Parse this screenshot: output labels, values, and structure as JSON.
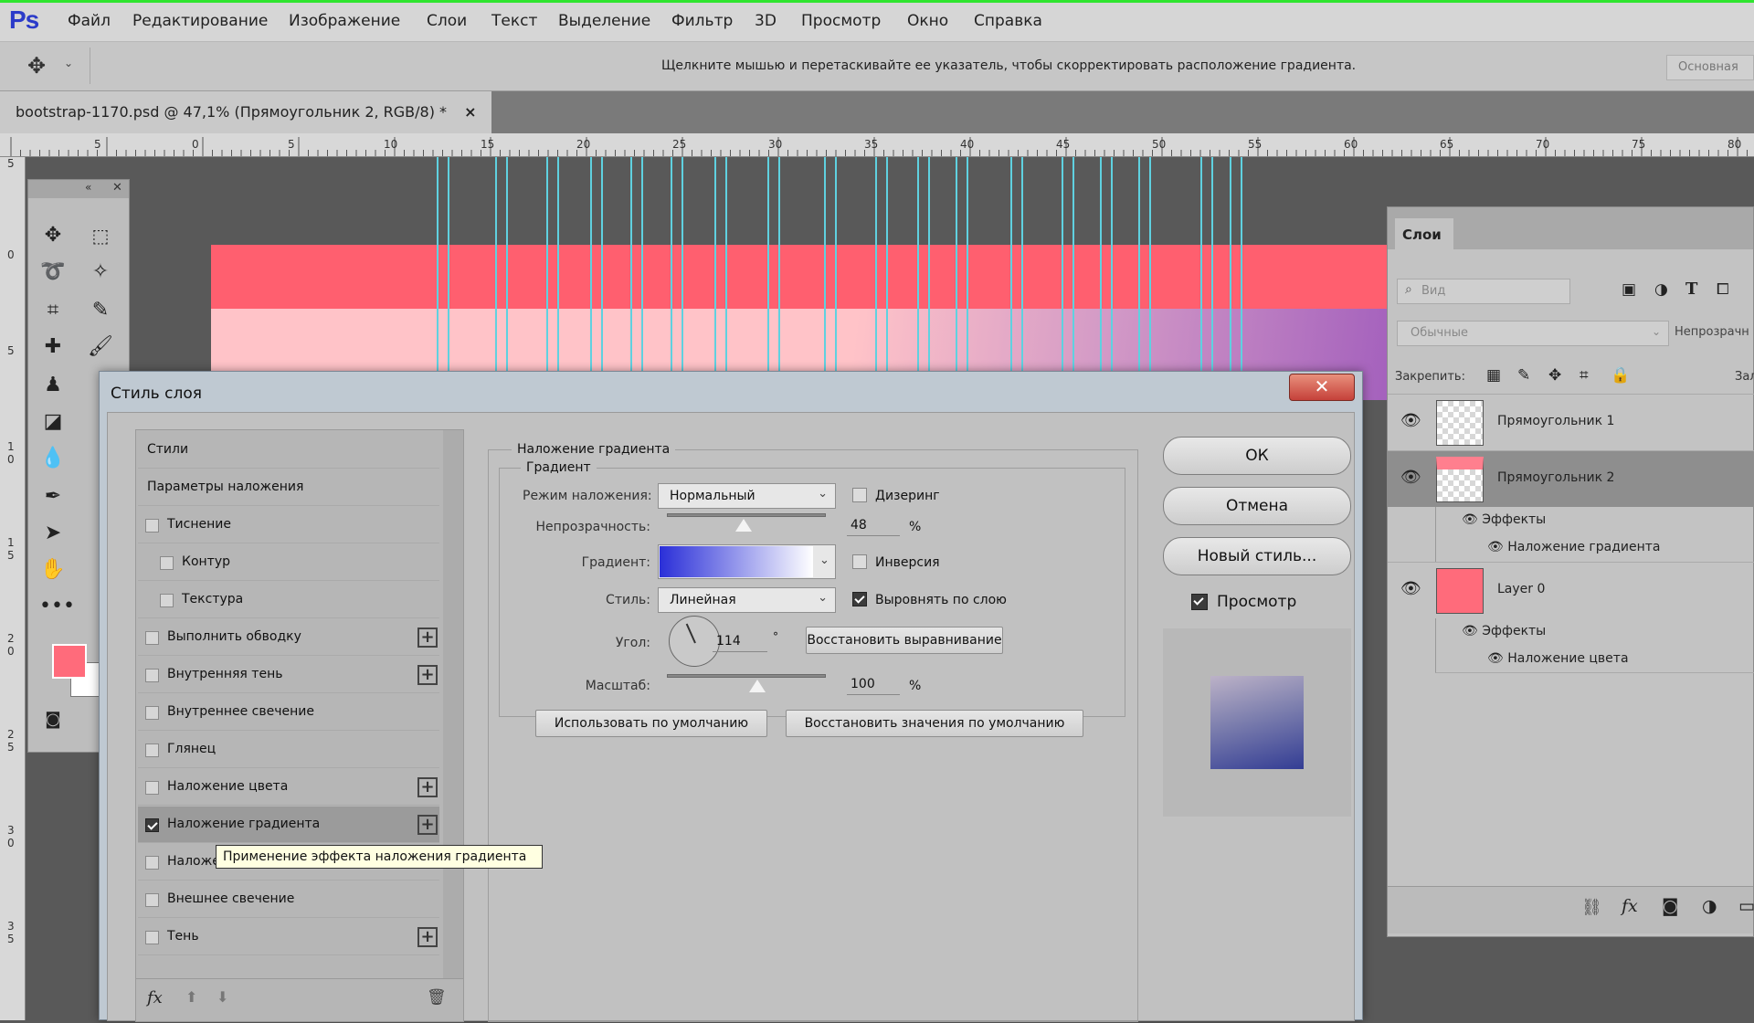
{
  "app": {
    "logo": "Ps"
  },
  "menu": [
    "Файл",
    "Редактирование",
    "Изображение",
    "Слои",
    "Текст",
    "Выделение",
    "Фильтр",
    "3D",
    "Просмотр",
    "Окно",
    "Справка"
  ],
  "options_bar": {
    "hint": "Щелкните мышью и перетаскивайте ее указатель, чтобы скорректировать расположение градиента.",
    "workspace": "Основная"
  },
  "document": {
    "tab_title": "bootstrap-1170.psd @ 47,1% (Прямоугольник 2, RGB/8) *",
    "close": "×"
  },
  "ruler_top": [
    "5",
    "0",
    "5",
    "10",
    "15",
    "20",
    "25",
    "30",
    "35",
    "40",
    "45",
    "50",
    "55",
    "60",
    "65",
    "70",
    "75",
    "80"
  ],
  "ruler_left": [
    "5",
    "0",
    "5",
    "1 0",
    "1 5",
    "2 0",
    "2 5",
    "3 0",
    "3 5"
  ],
  "colors": {
    "foreground": "#ff6b7b",
    "background": "#ffffff",
    "canvas_red": "#ff5f6f",
    "accent": "#2b3bc9"
  },
  "layers_panel": {
    "tab": "Слои",
    "search_placeholder": "Вид",
    "blend_mode": "Обычные",
    "opacity_label": "Непрозрачн",
    "lock_label": "Закрепить:",
    "fill_label": "Зал",
    "layers": [
      {
        "name": "Прямоугольник 1",
        "visible": true
      },
      {
        "name": "Прямоугольник 2",
        "visible": true,
        "selected": true,
        "effects_label": "Эффекты",
        "effects": [
          "Наложение градиента"
        ]
      },
      {
        "name": "Layer 0",
        "visible": true,
        "effects_label": "Эффекты",
        "effects": [
          "Наложение цвета"
        ]
      }
    ]
  },
  "dialog": {
    "title": "Стиль слоя",
    "close": "✕",
    "styles": [
      {
        "label": "Стили",
        "check": false,
        "header": true
      },
      {
        "label": "Параметры наложения",
        "check": false,
        "header": true
      },
      {
        "label": "Тиснение",
        "checked": false
      },
      {
        "label": "Контур",
        "checked": false,
        "indent": true
      },
      {
        "label": "Текстура",
        "checked": false,
        "indent": true
      },
      {
        "label": "Выполнить обводку",
        "checked": false,
        "plus": true
      },
      {
        "label": "Внутренняя тень",
        "checked": false,
        "plus": true
      },
      {
        "label": "Внутреннее свечение",
        "checked": false
      },
      {
        "label": "Глянец",
        "checked": false
      },
      {
        "label": "Наложение цвета",
        "checked": false,
        "plus": true
      },
      {
        "label": "Наложение градиента",
        "checked": true,
        "plus": true,
        "selected": true
      },
      {
        "label": "Наложен",
        "checked": false
      },
      {
        "label": "Внешнее свечение",
        "checked": false
      },
      {
        "label": "Тень",
        "checked": false,
        "plus": true
      }
    ],
    "tooltip": "Применение эффекта наложения градиента",
    "section_title": "Наложение градиента",
    "subsection_title": "Градиент",
    "blend_mode_label": "Режим наложения:",
    "blend_mode_value": "Нормальный",
    "dither_label": "Дизеринг",
    "dither_checked": false,
    "opacity_label": "Непрозрачность:",
    "opacity_value": "48",
    "opacity_fraction": 0.48,
    "percent": "%",
    "gradient_label": "Градиент:",
    "gradient_colors": [
      "#2a2fd8",
      "#ffffff"
    ],
    "reverse_label": "Инверсия",
    "reverse_checked": false,
    "style_label": "Стиль:",
    "style_value": "Линейная",
    "align_label": "Выровнять по слою",
    "align_checked": true,
    "angle_label": "Угол:",
    "angle_value": "114",
    "degree": "°",
    "reset_align": "Восстановить выравнивание",
    "scale_label": "Масштаб:",
    "scale_value": "100",
    "scale_fraction": 0.57,
    "default_btn": "Использовать по умолчанию",
    "reset_default_btn": "Восстановить значения по умолчанию",
    "ok": "ОК",
    "cancel": "Отмена",
    "new_style": "Новый стиль...",
    "preview_label": "Просмотр",
    "preview_checked": true
  }
}
